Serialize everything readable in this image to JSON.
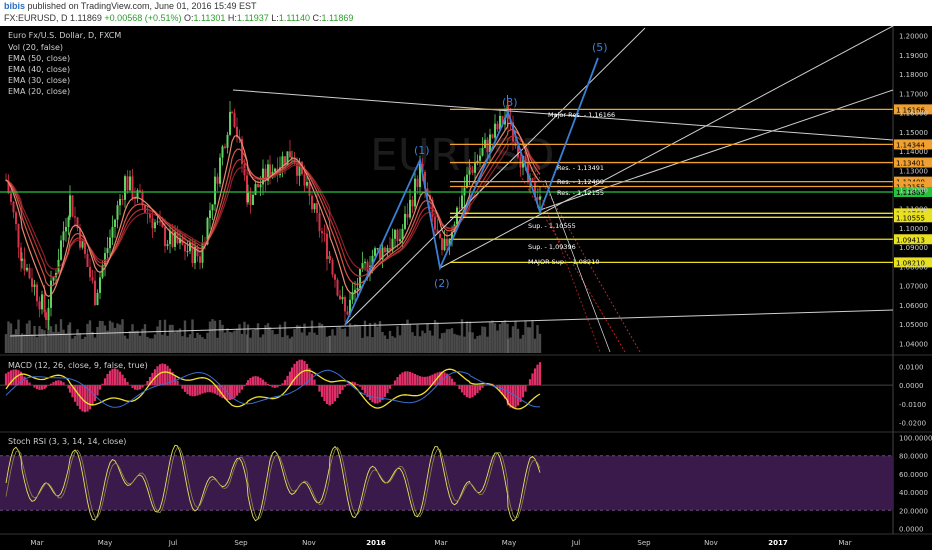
{
  "header": {
    "author": "bibis",
    "published": "published on TradingView.com, June 01, 2016 15:49 EST",
    "symbol_line": "FX:EURUSD, D",
    "price": "1.11869",
    "change": "+0.00568 (+0.51%)",
    "ohlc": {
      "o_label": "O:",
      "o": "1.11301",
      "h_label": "H:",
      "h": "1.11937",
      "l_label": "L:",
      "l": "1.11140",
      "c_label": "C:",
      "c": "1.11869"
    }
  },
  "overlays": {
    "main": [
      "Euro Fx/U.S. Dollar, D, FXCM",
      "Vol (20, false)",
      "EMA (50, close)",
      "EMA (40, close)",
      "EMA (30, close)",
      "EMA (20, close)"
    ],
    "macd": "MACD (12, 26, close, 9, false, true)",
    "rsi": "Stoch RSI (3, 3, 14, 14, close)"
  },
  "watermark": "EURUSD",
  "colors": {
    "up": "#5fd35f",
    "down": "#d6324a",
    "wave": "#3a7fd4",
    "resistance": "#f0a030",
    "support": "#e8e020",
    "current": "#26c23c",
    "macd_hist": "#e0306a",
    "macd_line": "#f0e030",
    "rsi_bg": "#3a1a4a",
    "rsi_line": "#e8e060"
  },
  "chart_data": [
    {
      "type": "line",
      "title": "Euro Fx/U.S. Dollar, D, FXCM",
      "x_ticks": [
        "Mar",
        "May",
        "Jul",
        "Sep",
        "Nov",
        "2016",
        "Mar",
        "May",
        "Jul",
        "Sep",
        "Nov",
        "2017",
        "Mar"
      ],
      "y_ticks": [
        "1.20000",
        "1.19000",
        "1.18000",
        "1.17000",
        "1.16000",
        "1.15000",
        "1.14000",
        "1.13000",
        "1.12000",
        "1.11000",
        "1.10000",
        "1.09000",
        "1.08000",
        "1.07000",
        "1.06000",
        "1.05000",
        "1.04000"
      ],
      "ylim": [
        1.035,
        1.205
      ],
      "price_labels": [
        {
          "value": 1.16166,
          "text": "1.16166",
          "kind": "resistance"
        },
        {
          "value": 1.14344,
          "text": "1.14344",
          "kind": "resistance"
        },
        {
          "value": 1.13401,
          "text": "1.13401",
          "kind": "resistance"
        },
        {
          "value": 1.12409,
          "text": "1.12409",
          "kind": "resistance"
        },
        {
          "value": 1.12155,
          "text": "1.12155",
          "kind": "resistance"
        },
        {
          "value": 1.11869,
          "text": "1.11869",
          "kind": "current"
        },
        {
          "value": 1.10761,
          "text": "1.10761",
          "kind": "support"
        },
        {
          "value": 1.10555,
          "text": "1.10555",
          "kind": "support"
        },
        {
          "value": 1.09413,
          "text": "1.09413",
          "kind": "support"
        },
        {
          "value": 1.0821,
          "text": "1.08210",
          "kind": "support"
        }
      ],
      "annotations": [
        "Major Res. - 1,16166",
        "Res. - 1,13491",
        "Res. - 1,12409",
        "Res. - 1,12155",
        "Sup. - 1,10555",
        "Sup. - 1,09396",
        "MAJOR Sup. - 1,08210"
      ],
      "wave_labels": [
        "(1)",
        "(2)",
        "(3)",
        "(5)"
      ]
    },
    {
      "type": "bar",
      "title": "MACD (12, 26, close, 9, false, true)",
      "y_ticks": [
        "0.0100",
        "0.0000",
        "-0.0100",
        "-0.0200"
      ],
      "ylim": [
        -0.025,
        0.015
      ]
    },
    {
      "type": "line",
      "title": "Stoch RSI (3, 3, 14, 14, close)",
      "y_ticks": [
        "100.0000",
        "80.0000",
        "60.0000",
        "40.0000",
        "20.0000",
        "0.0000"
      ],
      "ylim": [
        -5,
        105
      ]
    }
  ]
}
